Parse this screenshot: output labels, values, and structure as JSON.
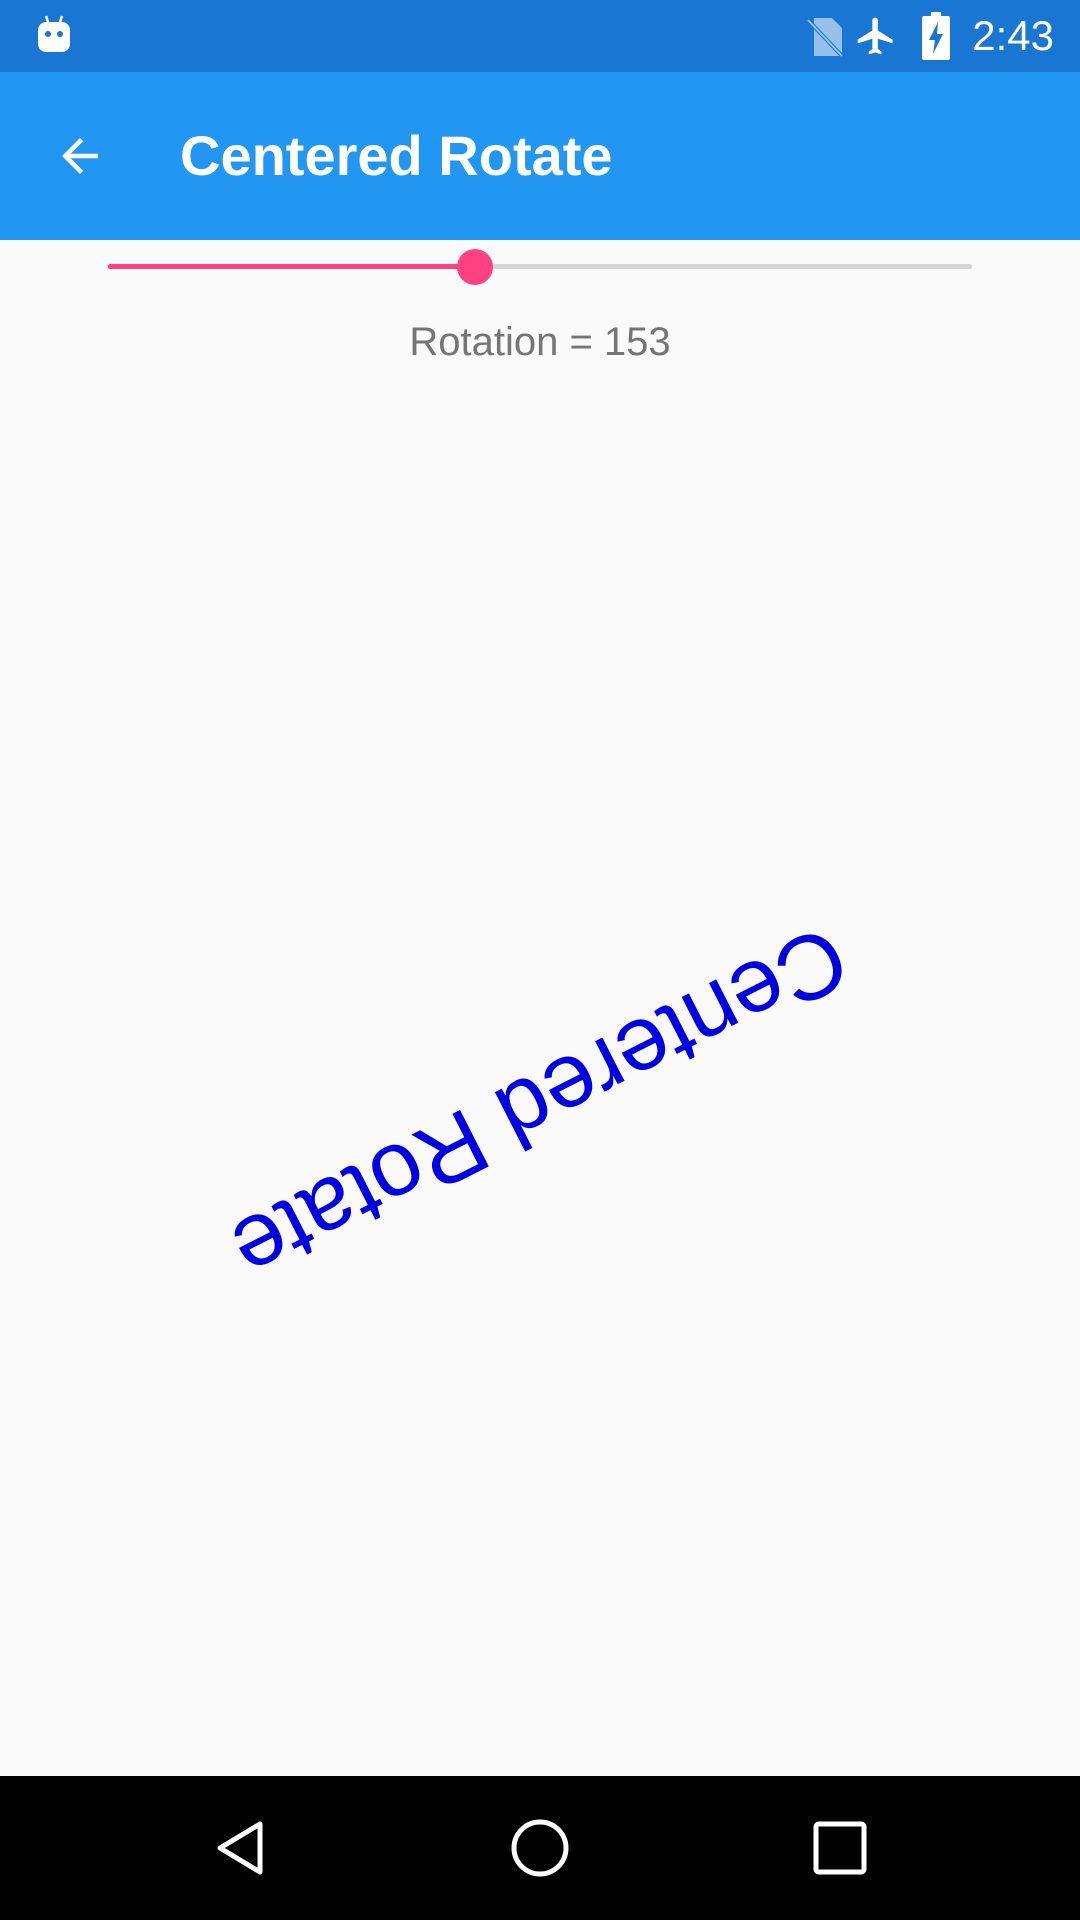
{
  "status_bar": {
    "time": "2:43",
    "icons": [
      "android-debug-icon",
      "no-sim-icon",
      "airplane-mode-icon",
      "battery-charging-icon"
    ]
  },
  "app_bar": {
    "title": "Centered Rotate",
    "back_icon": "arrow-left-icon"
  },
  "slider": {
    "value": 153,
    "min": 0,
    "max": 360,
    "fill_color": "#ff4081",
    "track_color": "#d6d6d6"
  },
  "rotation_label": "Rotation = 153",
  "rotated_text": {
    "text": "Centered Rotate",
    "angle_degrees": 153,
    "color": "#0000e0"
  },
  "nav_bar": {
    "buttons": [
      "back-triangle-icon",
      "home-circle-icon",
      "recents-square-icon"
    ]
  },
  "colors": {
    "status_bar": "#1976d2",
    "app_bar": "#2196f3",
    "background": "#fafafa",
    "accent": "#ff4081"
  }
}
